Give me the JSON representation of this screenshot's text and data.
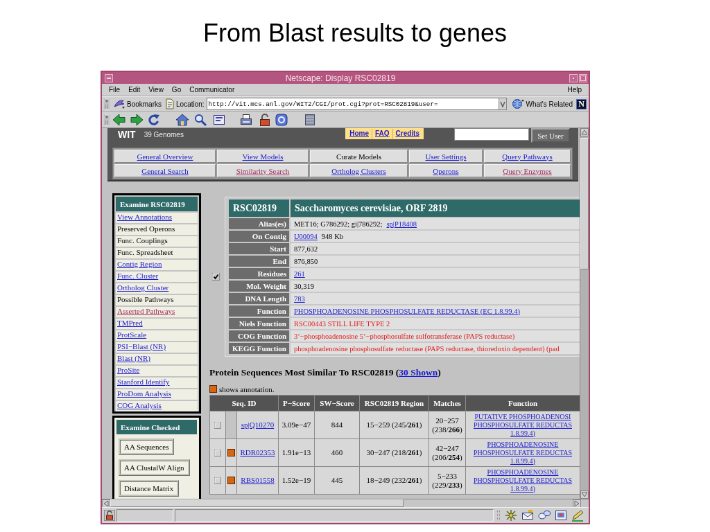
{
  "slide": {
    "title": "From Blast results to genes"
  },
  "window": {
    "title": "Netscape: Display RSC02819"
  },
  "menu": {
    "left": [
      "File",
      "Edit",
      "View",
      "Go",
      "Communicator"
    ],
    "right": [
      "Help"
    ]
  },
  "location_bar": {
    "bookmarks": "Bookmarks",
    "location_label": "Location:",
    "url": "http://vit.mcs.anl.gov/WIT2/CGI/prot.cgi?prot=RSC02819&user=",
    "related": "What's Related",
    "logo": "N"
  },
  "site_header": {
    "logo": "WIT",
    "genomes": "39 Genomes",
    "links": [
      "Home",
      "FAQ",
      "Credits"
    ],
    "set_user": "Set User"
  },
  "nav": [
    [
      {
        "label": "General Overview",
        "kind": "link"
      },
      {
        "label": "View Models",
        "kind": "link"
      },
      {
        "label": "Curate Models",
        "kind": "text"
      },
      {
        "label": "User Settings",
        "kind": "link"
      },
      {
        "label": "Query Pathways",
        "kind": "link"
      }
    ],
    [
      {
        "label": "General Search",
        "kind": "link"
      },
      {
        "label": "Similarity Search",
        "kind": "visited"
      },
      {
        "label": "Ortholog Clusters",
        "kind": "link"
      },
      {
        "label": "Operons",
        "kind": "link"
      },
      {
        "label": "Query Enzymes",
        "kind": "visited"
      }
    ]
  ],
  "examine": {
    "title": "Examine RSC02819",
    "items": [
      {
        "label": "View Annotations",
        "kind": "link"
      },
      {
        "label": "Preserved Operons",
        "kind": "text"
      },
      {
        "label": "Func. Couplings",
        "kind": "text"
      },
      {
        "label": "Func. Spreadsheet",
        "kind": "text"
      },
      {
        "label": "Contig Region",
        "kind": "link"
      },
      {
        "label": "Func. Cluster",
        "kind": "link"
      },
      {
        "label": "Ortholog Cluster",
        "kind": "link"
      },
      {
        "label": "Possible Pathways",
        "kind": "text"
      },
      {
        "label": "Asserted Pathways",
        "kind": "visited"
      },
      {
        "label": "TMPred",
        "kind": "link"
      },
      {
        "label": "ProtScale",
        "kind": "link"
      },
      {
        "label": "PSI−Blast (NR)",
        "kind": "link"
      },
      {
        "label": "Blast (NR)",
        "kind": "link"
      },
      {
        "label": "ProSite",
        "kind": "link"
      },
      {
        "label": "Stanford Identify",
        "kind": "link"
      },
      {
        "label": "ProDom Analysis",
        "kind": "link"
      },
      {
        "label": "COG Analysis",
        "kind": "link"
      }
    ]
  },
  "examine_checked": {
    "title": "Examine Checked",
    "buttons": [
      "AA Sequences",
      "AA ClustalW Align",
      "Distance Matrix"
    ]
  },
  "gene": {
    "checked": true,
    "id": "RSC02819",
    "organism": "Saccharomyces cerevisiae, ORF 2819",
    "fields": [
      {
        "label": "Alias(es)",
        "parts": [
          {
            "kind": "text",
            "text": "MET16; G786292; gi|786292;"
          },
          {
            "kind": "link",
            "text": "sp|P18408"
          }
        ]
      },
      {
        "label": "On Contig",
        "parts": [
          {
            "kind": "link",
            "text": "U00094"
          },
          {
            "kind": "text",
            "text": "948 Kb"
          }
        ]
      },
      {
        "label": "Start",
        "parts": [
          {
            "kind": "text",
            "text": "877,632"
          }
        ]
      },
      {
        "label": "End",
        "parts": [
          {
            "kind": "text",
            "text": "876,850"
          }
        ]
      },
      {
        "label": "Residues",
        "parts": [
          {
            "kind": "link",
            "text": "261"
          }
        ]
      },
      {
        "label": "Mol. Weight",
        "parts": [
          {
            "kind": "text",
            "text": "30,319"
          }
        ]
      },
      {
        "label": "DNA Length",
        "parts": [
          {
            "kind": "link",
            "text": "783"
          }
        ]
      },
      {
        "label": "Function",
        "parts": [
          {
            "kind": "link",
            "text": "PHOSPHOADENOSINE PHOSPHOSULFATE REDUCTASE (EC 1.8.99.4)"
          }
        ]
      },
      {
        "label": "Niels Function",
        "parts": [
          {
            "kind": "note",
            "text": "RSC00443 STILL LIFE TYPE 2"
          }
        ]
      },
      {
        "label": "COG Function",
        "parts": [
          {
            "kind": "note",
            "text": "3’−phosphoadenosine 5’−phosphosulfate sulfotransferase (PAPS reductase)"
          }
        ]
      },
      {
        "label": "KEGG Function",
        "parts": [
          {
            "kind": "note",
            "text": "phosphoadenosine phosphosulfate reductase (PAPS reductase, thioredoxin dependent) (pad"
          }
        ]
      }
    ]
  },
  "similar": {
    "heading": {
      "before": "Protein Sequences Most Similar To RSC02819 (",
      "link": "30 Shown",
      "after": ")"
    },
    "legend": "shows annotation.",
    "columns": [
      "Seq. ID",
      "P−Score",
      "SW−Score",
      "RSC02819 Region",
      "Matches",
      "Function"
    ],
    "rows": [
      {
        "checked": false,
        "annotated": false,
        "seq_id": "sp|Q10270",
        "p_score": "3.09e−47",
        "sw_score": "844",
        "region": "15−259 (245/**261**)",
        "matches": "20−257\n(238/**266**)",
        "function": "PUTATIVE PHOSPHOADENOSI\nPHOSPHOSULFATE REDUCTAS\n1.8.99.4)"
      },
      {
        "checked": false,
        "annotated": true,
        "seq_id": "RDR02353",
        "p_score": "1.91e−13",
        "sw_score": "460",
        "region": "30−247 (218/**261**)",
        "matches": "42−247\n(206/**254**)",
        "function": "PHOSPHOADENOSINE\nPHOSPHOSULFATE REDUCTAS\n1.8.99.4)"
      },
      {
        "checked": false,
        "annotated": true,
        "seq_id": "RBS01558",
        "p_score": "1.52e−19",
        "sw_score": "445",
        "region": "18−249 (232/**261**)",
        "matches": "5−233\n(229/**233**)",
        "function": "PHOSPHOADENOSINE\nPHOSPHOSULFATE REDUCTAS\n1.8.99.4)"
      }
    ]
  }
}
